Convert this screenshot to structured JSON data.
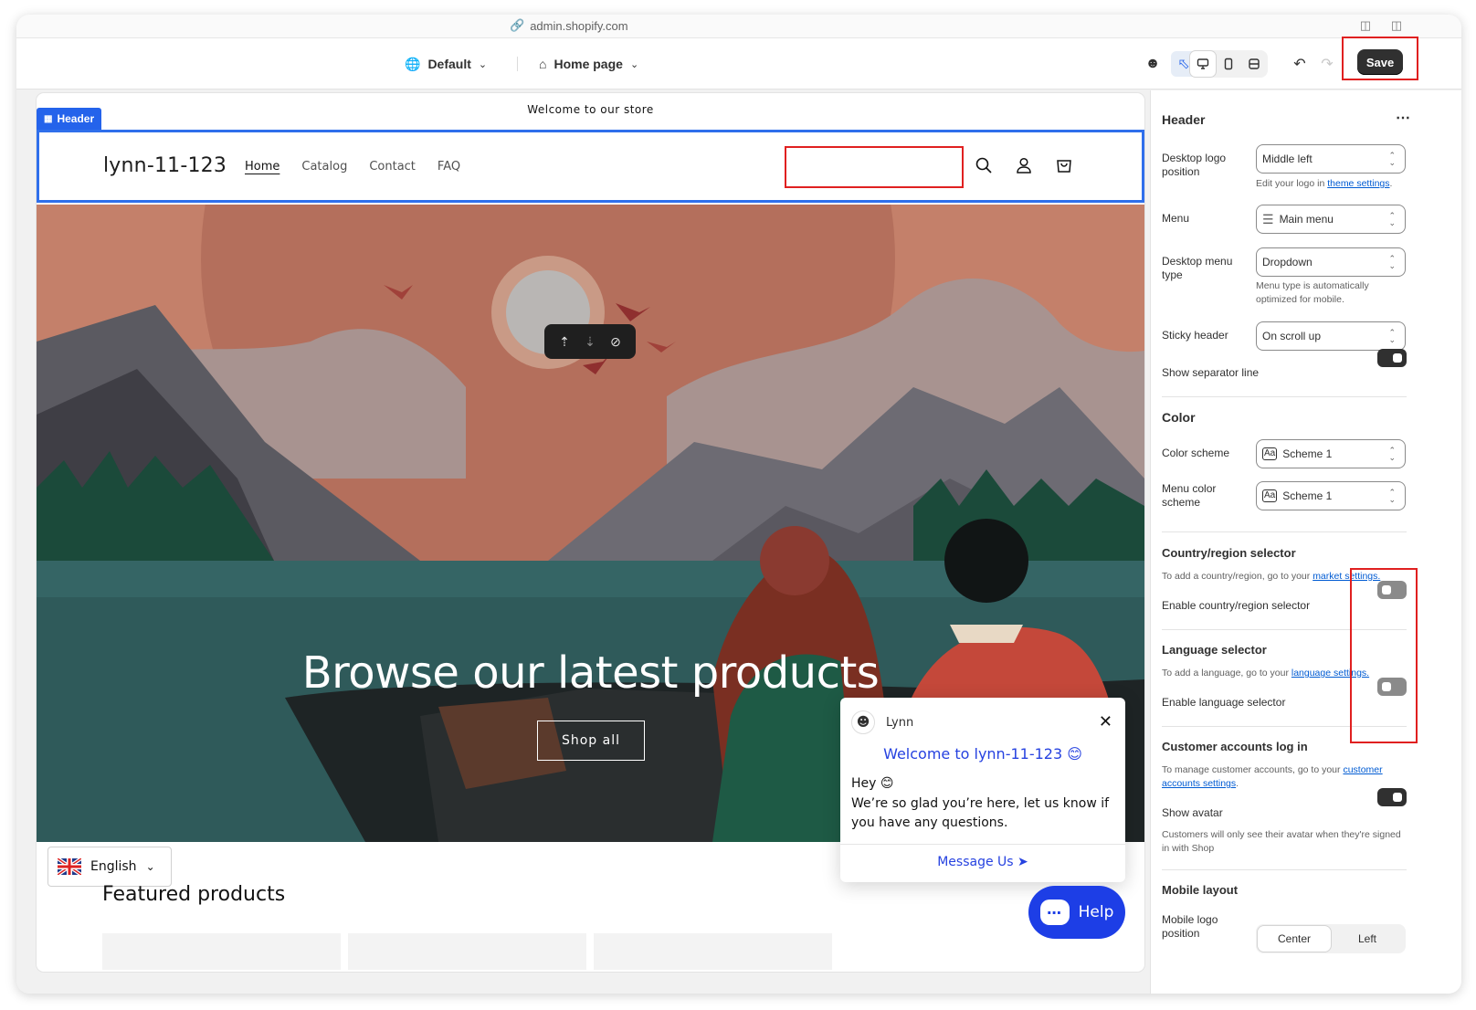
{
  "browser": {
    "url": "admin.shopify.com"
  },
  "toolbar": {
    "theme_label": "Default",
    "page_label": "Home page",
    "save_label": "Save"
  },
  "store": {
    "announcement": "Welcome to our store",
    "section_tag": "Header",
    "logo_text": "lynn-11-123",
    "nav": [
      "Home",
      "Catalog",
      "Contact",
      "FAQ"
    ],
    "hero_title": "Browse our latest products",
    "hero_button": "Shop all",
    "featured_title": "Featured products",
    "language": "English"
  },
  "chat": {
    "agent_name": "Lynn",
    "welcome": "Welcome to lynn-11-123 😊",
    "greeting": "Hey 😊",
    "message": "We’re so glad you’re here, let us know if you have any questions.",
    "action": "Message Us",
    "help_label": "Help"
  },
  "panel": {
    "title": "Header",
    "desktop_logo_position_label": "Desktop logo position",
    "desktop_logo_position_value": "Middle left",
    "logo_help_prefix": "Edit your logo in ",
    "logo_help_link": "theme settings",
    "logo_help_suffix": ".",
    "menu_label": "Menu",
    "menu_value": "Main menu",
    "desktop_menu_type_label": "Desktop menu type",
    "desktop_menu_type_value": "Dropdown",
    "menu_type_help": "Menu type is automatically optimized for mobile.",
    "sticky_header_label": "Sticky header",
    "sticky_header_value": "On scroll up",
    "separator_label": "Show separator line",
    "separator_on": true,
    "color_title": "Color",
    "color_scheme_label": "Color scheme",
    "color_scheme_value": "Scheme 1",
    "menu_color_scheme_label": "Menu color scheme",
    "menu_color_scheme_value": "Scheme 1",
    "aa_glyph": "Aa",
    "country_title": "Country/region selector",
    "country_note_prefix": "To add a country/region, go to your ",
    "country_note_link": "market settings.",
    "country_toggle_label": "Enable country/region selector",
    "country_on": false,
    "language_title": "Language selector",
    "language_note_prefix": "To add a language, go to your ",
    "language_note_link": "language settings.",
    "language_toggle_label": "Enable language selector",
    "language_on": false,
    "accounts_title": "Customer accounts log in",
    "accounts_note_prefix": "To manage customer accounts, go to your ",
    "accounts_note_link": "customer accounts settings",
    "accounts_note_suffix": ".",
    "avatar_label": "Show avatar",
    "avatar_on": true,
    "avatar_note": "Customers will only see their avatar when they're signed in with Shop",
    "mobile_title": "Mobile layout",
    "mobile_logo_label": "Mobile logo position",
    "mobile_options": [
      "Center",
      "Left"
    ],
    "mobile_selected": "Center"
  },
  "colors": {
    "accent": "#2463eb",
    "save_bg": "#303030",
    "highlight_red": "#e02020",
    "help_blue": "#1d3ee6"
  }
}
